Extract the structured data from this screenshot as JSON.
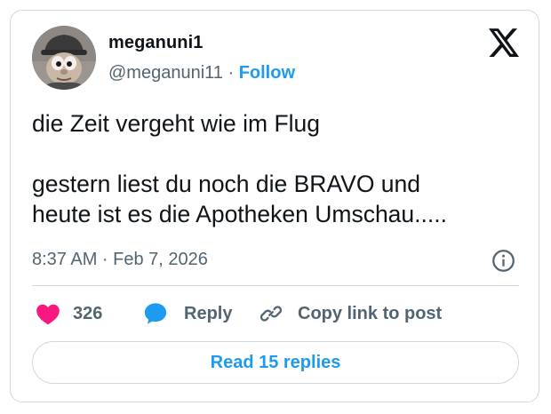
{
  "author": {
    "display_name": "meganuni1",
    "handle": "@meganuni11",
    "separator": " · ",
    "follow_label": "Follow"
  },
  "tweet": {
    "text": "die Zeit vergeht wie im Flug\n\ngestern liest du noch die BRAVO und\nheute ist es die Apotheken Umschau.....",
    "timestamp": "8:37 AM · Feb 7, 2026"
  },
  "actions": {
    "like_count": "326",
    "reply_label": "Reply",
    "copy_link_label": "Copy link to post"
  },
  "read_replies_label": "Read 15 replies",
  "icons": {
    "logo": "x-logo-icon",
    "info": "info-icon",
    "like": "heart-icon",
    "reply": "speech-bubble-icon",
    "copy": "link-icon"
  },
  "colors": {
    "link_blue": "#1d9bf0",
    "like_pink": "#f91880",
    "text": "#0f1419",
    "muted": "#536471",
    "border": "#cfd9de"
  }
}
